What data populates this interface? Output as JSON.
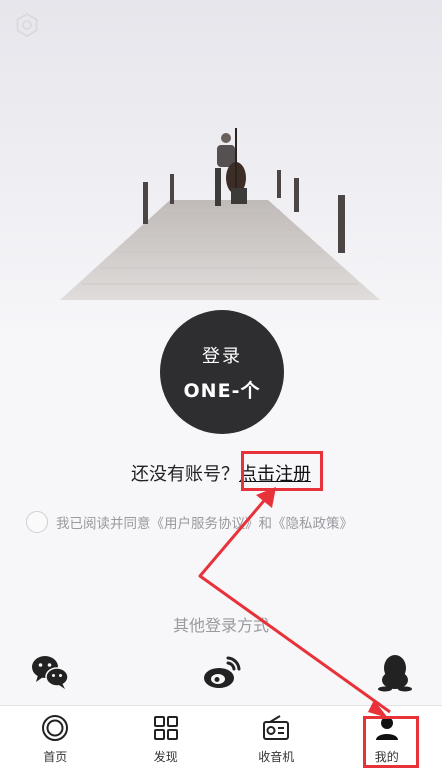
{
  "login": {
    "line1": "登录",
    "line2": "ONE-个"
  },
  "register": {
    "prompt": "还没有账号？",
    "link": "点击注册"
  },
  "agreement": {
    "prefix": "我已阅读并同意",
    "terms": "《用户服务协议》",
    "and": "和",
    "privacy": "《隐私政策》",
    "checked": false
  },
  "other_login": {
    "title": "其他登录方式",
    "icons": [
      "wechat-icon",
      "weibo-icon",
      "qq-icon"
    ]
  },
  "tabs": [
    {
      "label": "首页",
      "icon": "home-icon"
    },
    {
      "label": "发现",
      "icon": "grid-icon"
    },
    {
      "label": "收音机",
      "icon": "radio-icon"
    },
    {
      "label": "我的",
      "icon": "user-icon",
      "active": true
    }
  ],
  "annotation_color": "#e8323a"
}
